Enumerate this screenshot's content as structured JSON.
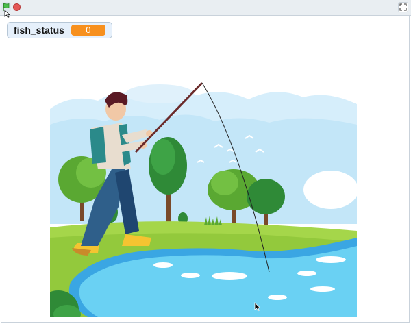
{
  "toolbar": {
    "flag_icon": "green-flag-icon",
    "stop_icon": "stop-icon",
    "fullscreen_icon": "fullscreen-icon"
  },
  "stage": {
    "monitor": {
      "label": "fish_status",
      "value": "0"
    },
    "backdrop": "fishing-scene"
  },
  "colors": {
    "monitor_value": "#f7901e",
    "stop": "#e45757",
    "lake": "#6ad1f3",
    "grass": "#a5d64a"
  }
}
